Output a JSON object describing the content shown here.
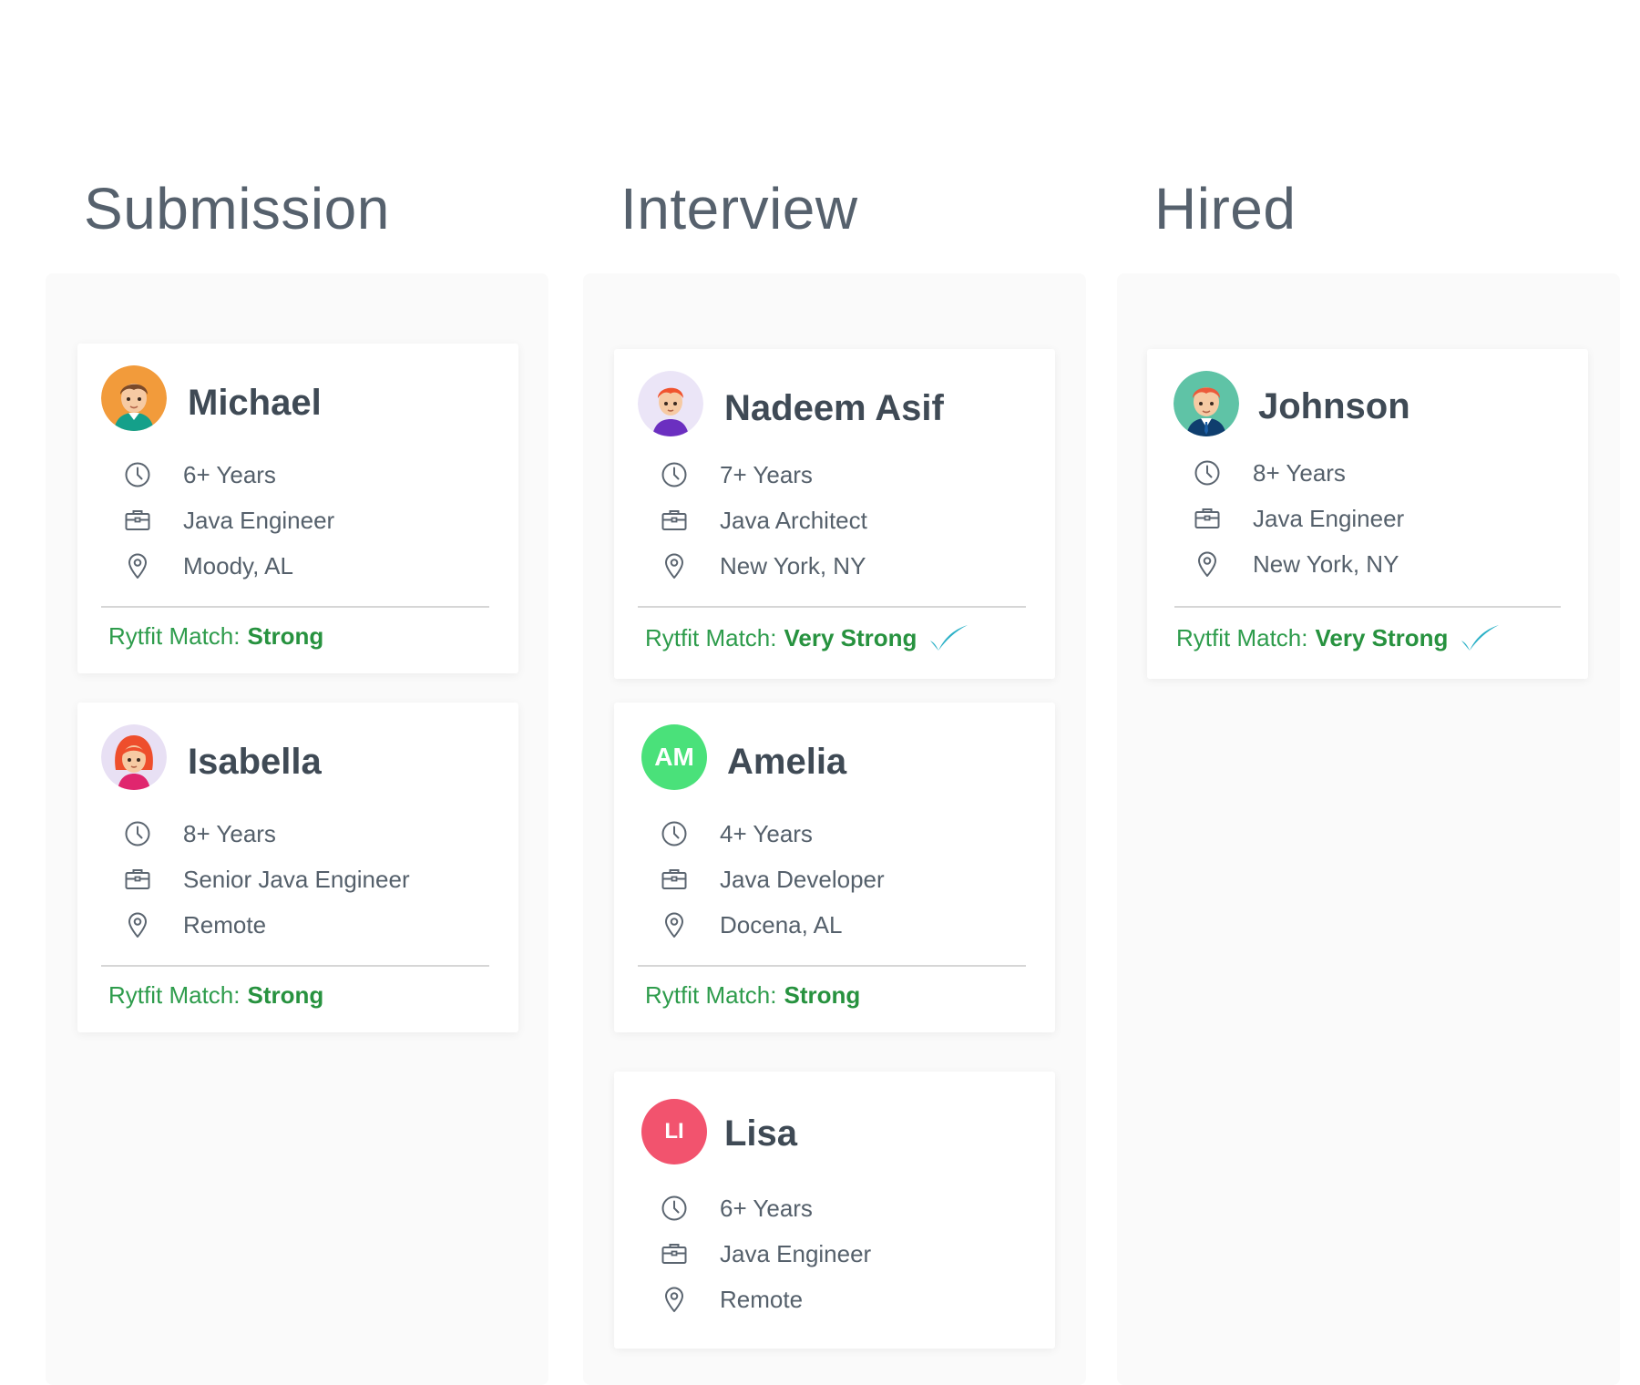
{
  "columns": [
    {
      "title": "Submission"
    },
    {
      "title": "Interview"
    },
    {
      "title": "Hired"
    }
  ],
  "match_label": "Rytfit Match:",
  "icons": {
    "experience": "clock-icon",
    "role": "briefcase-icon",
    "location": "map-pin-icon",
    "very_strong": "checkmark-icon"
  },
  "colors": {
    "match_text": "#2e9c4c",
    "check": "#2cb1c7",
    "avatar_am": "#4ae17a",
    "avatar_li": "#f2536e"
  },
  "cards": {
    "michael": {
      "name": "Michael",
      "experience": "6+ Years",
      "role": "Java Engineer",
      "location": "Moody, AL",
      "match": "Strong",
      "avatar": "illustrated-avatar"
    },
    "isabella": {
      "name": "Isabella",
      "experience": "8+ Years",
      "role": "Senior Java Engineer",
      "location": "Remote",
      "match": "Strong",
      "avatar": "illustrated-avatar"
    },
    "nadeem": {
      "name": "Nadeem Asif",
      "experience": "7+ Years",
      "role": "Java Architect",
      "location": "New York, NY",
      "match": "Very Strong",
      "avatar": "illustrated-avatar"
    },
    "amelia": {
      "name": "Amelia",
      "initials": "AM",
      "experience": "4+ Years",
      "role": "Java Developer",
      "location": "Docena, AL",
      "match": "Strong"
    },
    "lisa": {
      "name": "Lisa",
      "initials": "LI",
      "experience": "6+ Years",
      "role": "Java Engineer",
      "location": "Remote"
    },
    "johnson": {
      "name": "Johnson",
      "experience": "8+ Years",
      "role": "Java Engineer",
      "location": "New York, NY",
      "match": "Very Strong",
      "avatar": "illustrated-avatar"
    }
  }
}
